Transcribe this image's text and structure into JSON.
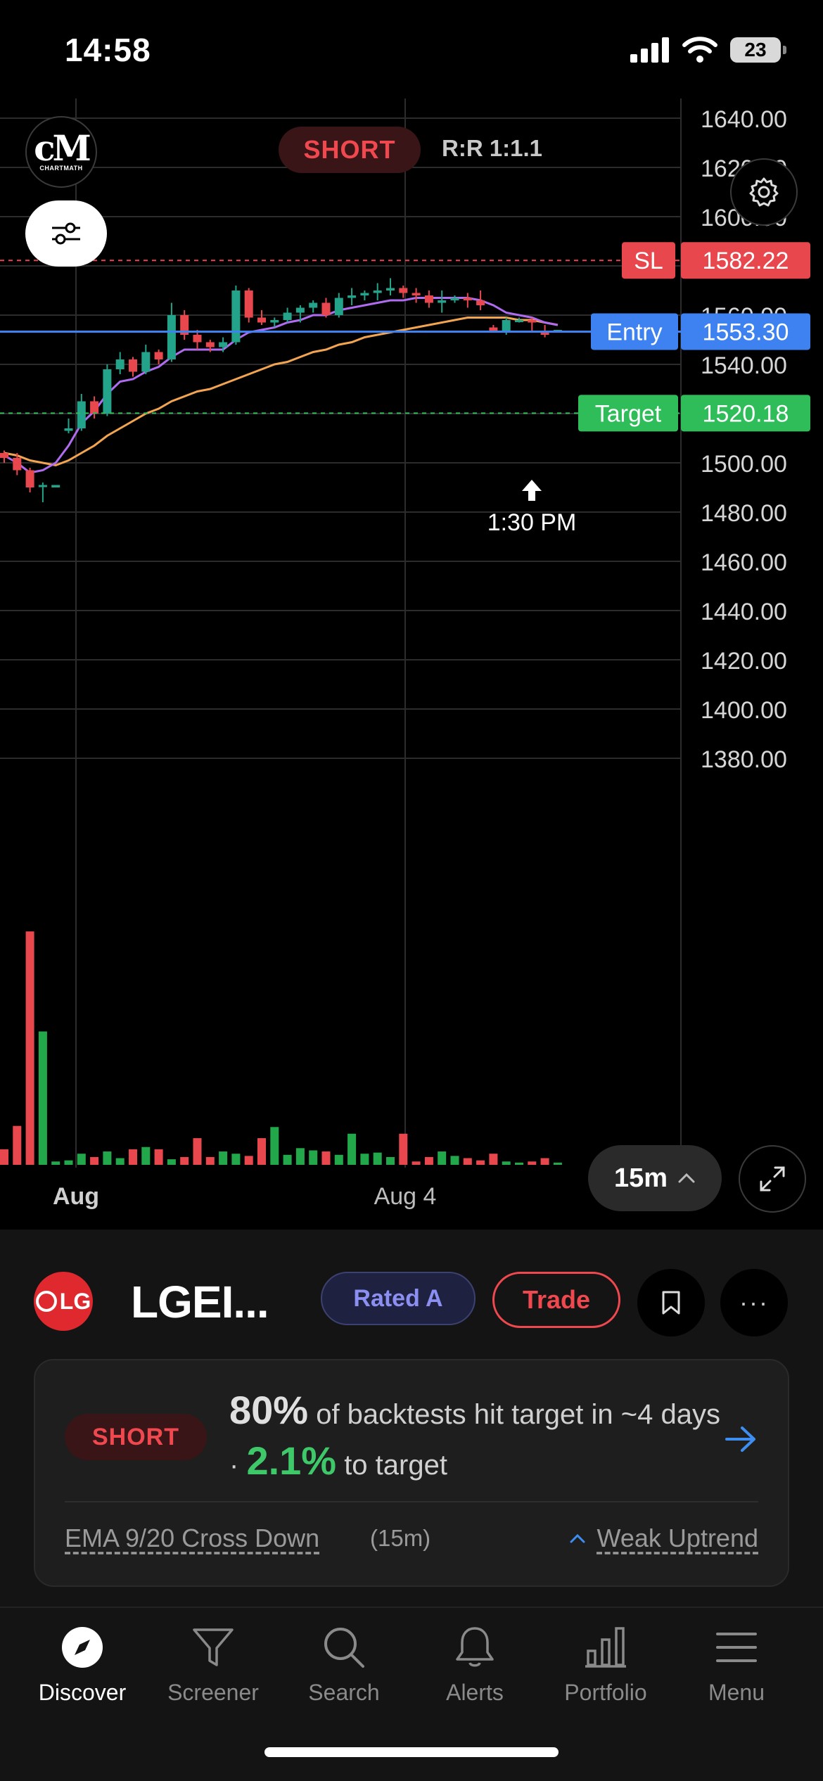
{
  "status_bar": {
    "time": "14:58",
    "battery": "23"
  },
  "chart_header": {
    "side": "SHORT",
    "risk_reward": "R:R 1:1.1",
    "logo_sub": "CHARTMATH"
  },
  "chart_data": {
    "type": "candlestick",
    "price_axis_labels": [
      "1640.00",
      "1620.00",
      "1600.00",
      "1560.00",
      "1540.00",
      "1500.00",
      "1480.00",
      "1460.00",
      "1440.00",
      "1420.00",
      "1400.00",
      "1380.00"
    ],
    "x_axis_labels": [
      "Aug",
      "Aug 4"
    ],
    "levels": [
      {
        "name": "SL",
        "price": "1582.22",
        "color": "#e8474d"
      },
      {
        "name": "Entry",
        "price": "1553.30",
        "color": "#3d82f0"
      },
      {
        "name": "Target",
        "price": "1520.18",
        "color": "#2ebd59"
      }
    ],
    "entry_marker_time": "1:30 PM",
    "candles": [
      [
        1504,
        1505,
        1500,
        1502
      ],
      [
        1502,
        1504,
        1495,
        1497
      ],
      [
        1497,
        1498,
        1488,
        1490
      ],
      [
        1491,
        1492,
        1484,
        1491
      ],
      [
        1490,
        1491,
        1490,
        1491
      ],
      [
        1513,
        1518,
        1512,
        1514
      ],
      [
        1514,
        1528,
        1513,
        1525
      ],
      [
        1525,
        1527,
        1518,
        1520
      ],
      [
        1520,
        1540,
        1519,
        1538
      ],
      [
        1538,
        1545,
        1536,
        1542
      ],
      [
        1542,
        1543,
        1535,
        1537
      ],
      [
        1537,
        1548,
        1536,
        1545
      ],
      [
        1545,
        1546,
        1540,
        1542
      ],
      [
        1542,
        1565,
        1541,
        1560
      ],
      [
        1560,
        1562,
        1550,
        1552
      ],
      [
        1552,
        1554,
        1546,
        1549
      ],
      [
        1549,
        1550,
        1545,
        1547
      ],
      [
        1547,
        1551,
        1545,
        1549
      ],
      [
        1549,
        1572,
        1548,
        1570
      ],
      [
        1570,
        1571,
        1557,
        1559
      ],
      [
        1559,
        1562,
        1556,
        1557
      ],
      [
        1557,
        1559,
        1555,
        1558
      ],
      [
        1558,
        1563,
        1557,
        1561
      ],
      [
        1561,
        1564,
        1557,
        1563
      ],
      [
        1563,
        1566,
        1561,
        1565
      ],
      [
        1565,
        1567,
        1559,
        1560
      ],
      [
        1560,
        1569,
        1559,
        1567
      ],
      [
        1567,
        1571,
        1564,
        1568
      ],
      [
        1568,
        1570,
        1566,
        1569
      ],
      [
        1569,
        1573,
        1566,
        1570
      ],
      [
        1570,
        1575,
        1568,
        1571
      ],
      [
        1571,
        1572,
        1567,
        1569
      ],
      [
        1569,
        1571,
        1565,
        1568
      ],
      [
        1568,
        1570,
        1563,
        1565
      ],
      [
        1565,
        1570,
        1561,
        1566
      ],
      [
        1566,
        1568,
        1565,
        1567
      ],
      [
        1567,
        1569,
        1563,
        1566
      ],
      [
        1566,
        1570,
        1562,
        1564
      ],
      [
        1555,
        1556,
        1553,
        1553
      ],
      [
        1553,
        1559,
        1552,
        1558
      ],
      [
        1558,
        1559,
        1557,
        1558
      ],
      [
        1558,
        1559,
        1553,
        1557
      ],
      [
        1553,
        1556,
        1551,
        1552
      ],
      [
        1553,
        1554,
        1553,
        1554
      ]
    ],
    "volumes": [
      14,
      35,
      210,
      120,
      3,
      4,
      10,
      7,
      12,
      6,
      14,
      16,
      14,
      5,
      7,
      24,
      7,
      12,
      10,
      8,
      24,
      34,
      9,
      15,
      13,
      12,
      9,
      28,
      10,
      11,
      7,
      28,
      3,
      7,
      12,
      8,
      6,
      4,
      10,
      3,
      2,
      3,
      6,
      2
    ],
    "ema_fast": [
      1503,
      1500,
      1496,
      1497,
      1500,
      1507,
      1516,
      1521,
      1528,
      1533,
      1534,
      1537,
      1539,
      1543,
      1546,
      1546,
      1546,
      1546,
      1550,
      1553,
      1554,
      1555,
      1557,
      1558,
      1560,
      1560,
      1562,
      1563,
      1564,
      1565,
      1566,
      1566,
      1567,
      1567,
      1567,
      1567,
      1567,
      1566,
      1564,
      1561,
      1560,
      1559,
      1557,
      1556
    ],
    "ema_slow": [
      1504,
      1503,
      1501,
      1500,
      1499,
      1501,
      1504,
      1507,
      1511,
      1514,
      1517,
      1520,
      1522,
      1525,
      1527,
      1529,
      1530,
      1532,
      1534,
      1536,
      1538,
      1540,
      1541,
      1543,
      1545,
      1546,
      1548,
      1549,
      1551,
      1552,
      1553,
      1554,
      1555,
      1556,
      1557,
      1558,
      1559,
      1559,
      1559,
      1559,
      1558,
      1558,
      1557,
      1556
    ]
  },
  "chart_controls": {
    "timeframe": "15m"
  },
  "ticker": {
    "symbol": "LGEI...",
    "logo_text": "LG",
    "rating": "Rated A",
    "trade": "Trade"
  },
  "signal": {
    "side": "SHORT",
    "pct": "80%",
    "text_mid": " of backtests hit target in ~4 days · ",
    "to_target": "2.1%",
    "text_end": " to target",
    "indicator": "EMA 9/20 Cross Down",
    "indicator_tf": "(15m)",
    "trend": "Weak Uptrend"
  },
  "tabs": [
    {
      "label": "Discover",
      "icon": "compass-icon",
      "active": true
    },
    {
      "label": "Screener",
      "icon": "filter-icon"
    },
    {
      "label": "Search",
      "icon": "search-icon"
    },
    {
      "label": "Alerts",
      "icon": "bell-icon"
    },
    {
      "label": "Portfolio",
      "icon": "bar-chart-icon"
    },
    {
      "label": "Menu",
      "icon": "hamburger-icon"
    }
  ]
}
